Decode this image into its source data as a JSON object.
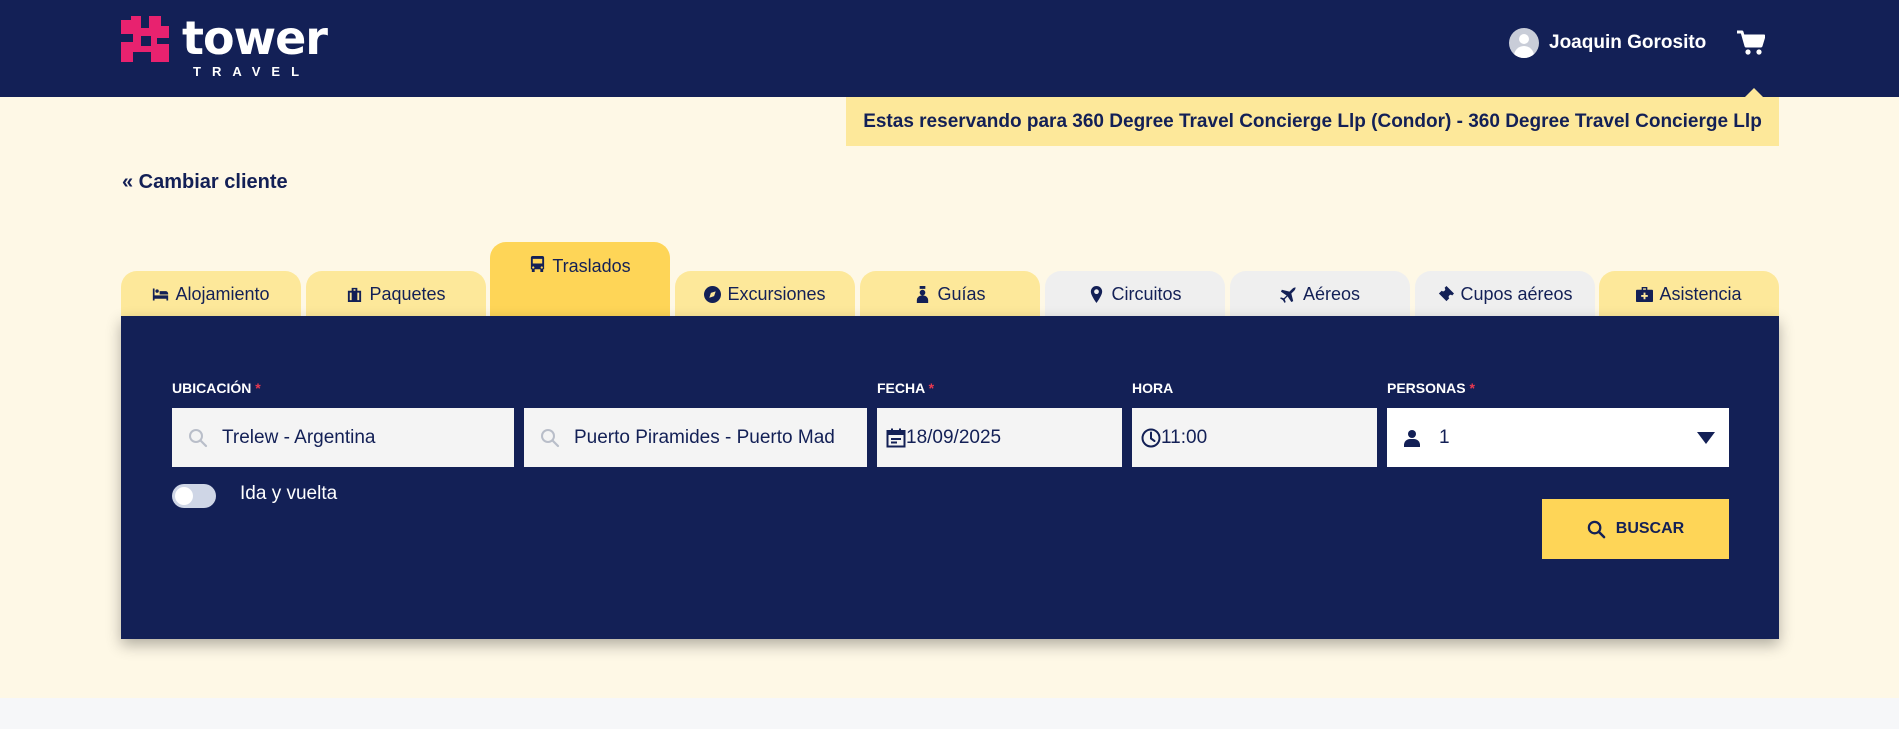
{
  "brand": {
    "name": "tower",
    "subtitle": "TRAVEL",
    "colors": {
      "navy": "#132056",
      "pink": "#e8226f",
      "yellow": "#fed557",
      "light_yellow": "#fde89a",
      "cream": "#fef8e6"
    }
  },
  "header": {
    "user_name": "Joaquin Gorosito",
    "user_icon": "user-avatar-icon",
    "cart_icon": "cart-icon"
  },
  "banner": {
    "text": "Estas reservando para 360 Degree Travel Concierge Llp (Condor) - 360 Degree Travel Concierge Llp"
  },
  "change_client": {
    "label": "« Cambiar cliente"
  },
  "tabs": [
    {
      "label": "Alojamiento",
      "icon": "bed-icon",
      "state": "normal"
    },
    {
      "label": "Paquetes",
      "icon": "suitcase-icon",
      "state": "normal"
    },
    {
      "label": "Traslados",
      "icon": "bus-icon",
      "state": "active"
    },
    {
      "label": "Excursiones",
      "icon": "compass-icon",
      "state": "normal"
    },
    {
      "label": "Guías",
      "icon": "guide-icon",
      "state": "normal"
    },
    {
      "label": "Circuitos",
      "icon": "map-pin-icon",
      "state": "inactive"
    },
    {
      "label": "Aéreos",
      "icon": "plane-icon",
      "state": "inactive"
    },
    {
      "label": "Cupos aéreos",
      "icon": "ticket-icon",
      "state": "inactive"
    },
    {
      "label": "Asistencia",
      "icon": "medical-kit-icon",
      "state": "normal"
    }
  ],
  "form": {
    "location_label": "UBICACIÓN",
    "date_label": "FECHA",
    "time_label": "HORA",
    "persons_label": "PERSONAS",
    "required_mark": "*",
    "origin": "Trelew - Argentina",
    "destination": "Puerto Piramides - Puerto Mad",
    "date": "18/09/2025",
    "time": "11:00",
    "persons": "1",
    "round_trip_label": "Ida y vuelta",
    "round_trip_on": false,
    "search_label": "BUSCAR"
  }
}
